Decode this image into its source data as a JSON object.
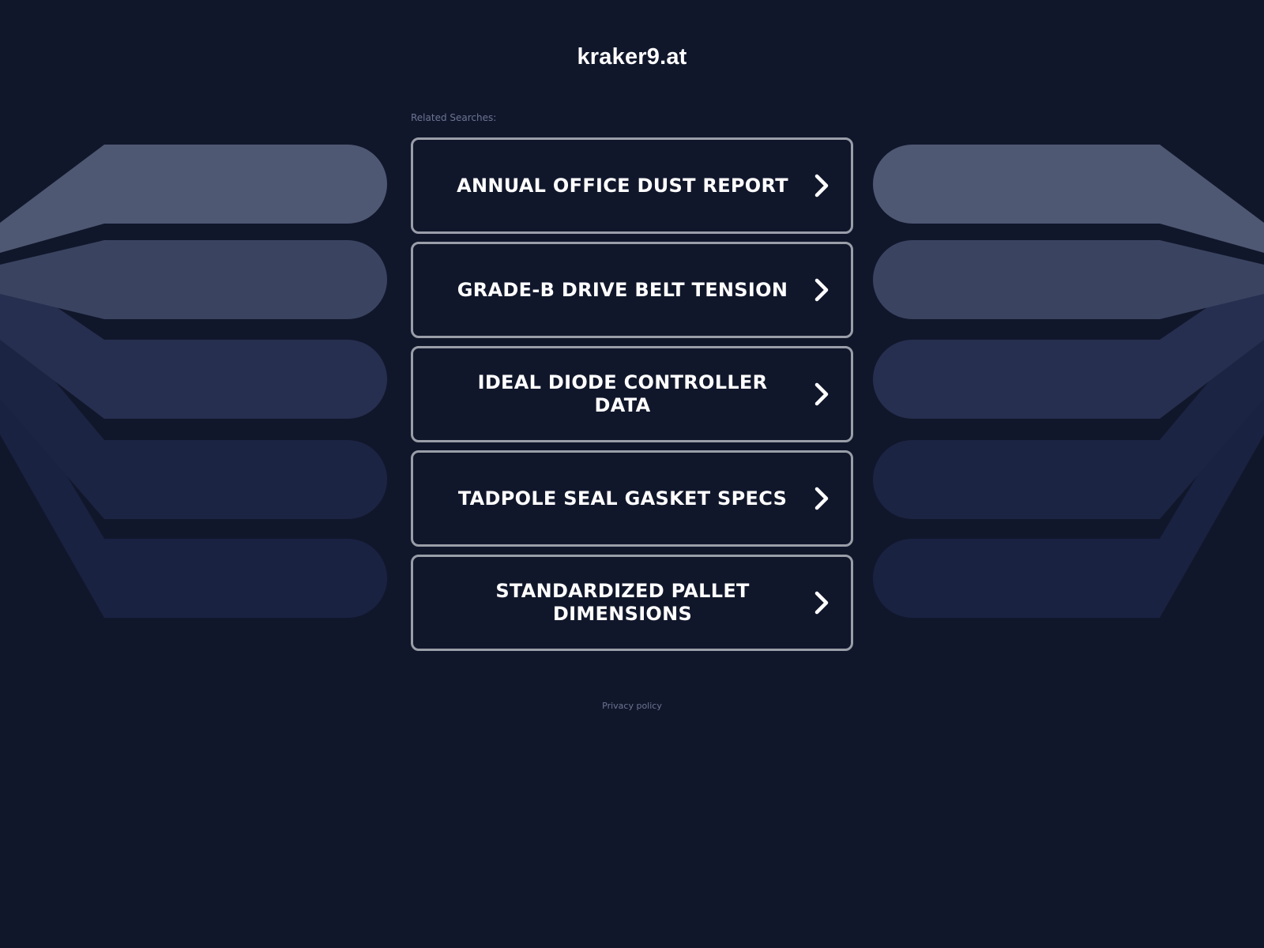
{
  "site": {
    "title": "kraker9.at"
  },
  "related": {
    "label": "Related Searches:",
    "links": [
      {
        "label": "ANNUAL OFFICE DUST REPORT"
      },
      {
        "label": "GRADE-B DRIVE BELT TENSION"
      },
      {
        "label": "IDEAL DIODE CONTROLLER DATA"
      },
      {
        "label": "TADPOLE SEAL GASKET SPECS"
      },
      {
        "label": "STANDARDIZED PALLET DIMENSIONS"
      }
    ]
  },
  "footer": {
    "privacy_label": "Privacy policy"
  },
  "colors": {
    "background": "#11172b",
    "button_border": "#9a9ea8",
    "text": "#ffffff",
    "muted_text": "#6b7493",
    "band_1": "#4e5873",
    "band_2": "#3a4461",
    "band_3": "#262f4f",
    "band_4": "#1c2443",
    "band_5": "#1a2242"
  },
  "icons": {
    "link_arrow": "chevron-right-icon"
  }
}
